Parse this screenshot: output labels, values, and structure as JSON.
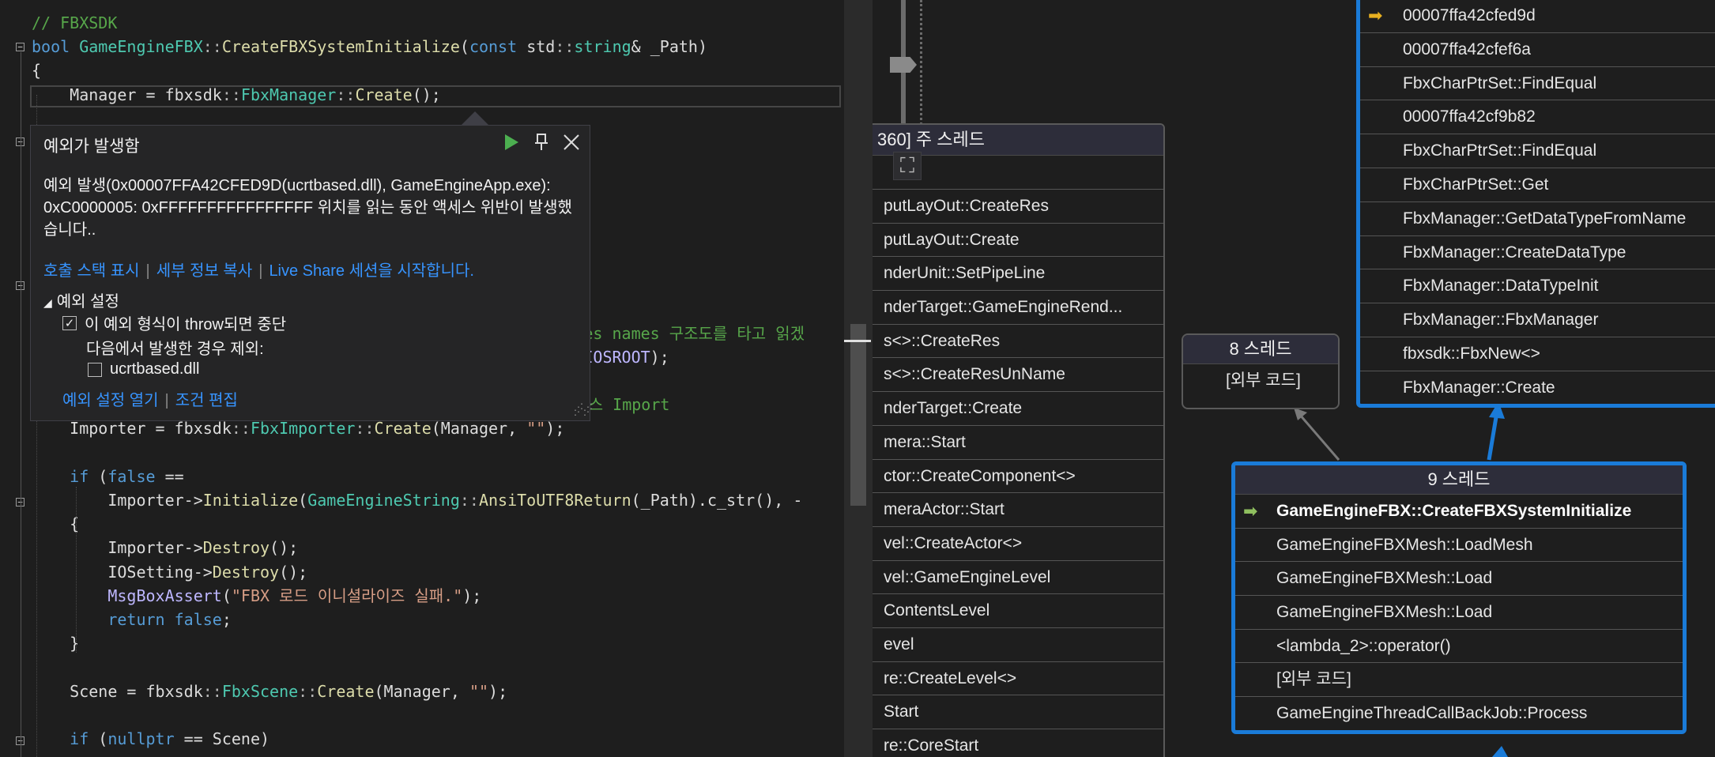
{
  "editor": {
    "lines": [
      [
        [
          "cm",
          "// FBXSDK"
        ]
      ],
      [
        [
          "kw",
          "bool "
        ],
        [
          "ty",
          "GameEngineFBX"
        ],
        [
          "op",
          "::"
        ],
        [
          "fn",
          "CreateFBXSystemInitialize"
        ],
        [
          "pl",
          "("
        ],
        [
          "kw",
          "const "
        ],
        [
          "pl",
          "std"
        ],
        [
          "op",
          "::"
        ],
        [
          "ty",
          "string"
        ],
        [
          "pl",
          "& _Path)"
        ]
      ],
      [
        [
          "pl",
          "{"
        ]
      ],
      [
        [
          "pl",
          "    Manager = fbxsdk"
        ],
        [
          "op",
          "::"
        ],
        [
          "ty",
          "FbxManager"
        ],
        [
          "op",
          "::"
        ],
        [
          "fn",
          "Create"
        ],
        [
          "pl",
          "();"
        ]
      ],
      [
        [
          "pl",
          ""
        ]
      ],
      [
        [
          "pl",
          ""
        ]
      ],
      [
        [
          "pl",
          ""
        ]
      ],
      [
        [
          "pl",
          ""
        ]
      ],
      [
        [
          "pl",
          ""
        ]
      ],
      [
        [
          "pl",
          ""
        ]
      ],
      [
        [
          "pl",
          ""
        ]
      ],
      [
        [
          "pl",
          ""
        ]
      ],
      [
        [
          "pl",
          ""
        ]
      ],
      [
        [
          "cm",
          "                                                          es names 구조도를 타고 읽겠"
        ]
      ],
      [
        [
          "mac",
          "                                                          IOSROOT"
        ],
        [
          "pl",
          ");"
        ]
      ],
      [
        [
          "pl",
          ""
        ]
      ],
      [
        [
          "cm",
          "                                                         래스 Import"
        ]
      ],
      [
        [
          "pl",
          "    Importer = fbxsdk"
        ],
        [
          "op",
          "::"
        ],
        [
          "ty",
          "FbxImporter"
        ],
        [
          "op",
          "::"
        ],
        [
          "fn",
          "Create"
        ],
        [
          "pl",
          "(Manager, "
        ],
        [
          "str",
          "\"\""
        ],
        [
          "pl",
          ");"
        ]
      ],
      [
        [
          "pl",
          ""
        ]
      ],
      [
        [
          "pl",
          "    "
        ],
        [
          "kw",
          "if "
        ],
        [
          "pl",
          "("
        ],
        [
          "kw",
          "false "
        ],
        [
          "pl",
          "=="
        ]
      ],
      [
        [
          "pl",
          "        Importer->"
        ],
        [
          "fn",
          "Initialize"
        ],
        [
          "pl",
          "("
        ],
        [
          "ty",
          "GameEngineString"
        ],
        [
          "op",
          "::"
        ],
        [
          "fn",
          "AnsiToUTF8Return"
        ],
        [
          "pl",
          "(_Path).c_str(), -"
        ]
      ],
      [
        [
          "pl",
          "    {"
        ]
      ],
      [
        [
          "pl",
          "        Importer->"
        ],
        [
          "fn",
          "Destroy"
        ],
        [
          "pl",
          "();"
        ]
      ],
      [
        [
          "pl",
          "        IOSetting->"
        ],
        [
          "fn",
          "Destroy"
        ],
        [
          "pl",
          "();"
        ]
      ],
      [
        [
          "pl",
          "        "
        ],
        [
          "mac",
          "MsgBoxAssert"
        ],
        [
          "pl",
          "("
        ],
        [
          "str",
          "\"FBX 로드 이니셜라이즈 실패.\""
        ],
        [
          "pl",
          ");"
        ]
      ],
      [
        [
          "pl",
          "        "
        ],
        [
          "kw",
          "return false"
        ],
        [
          "pl",
          ";"
        ]
      ],
      [
        [
          "pl",
          "    }"
        ]
      ],
      [
        [
          "pl",
          ""
        ]
      ],
      [
        [
          "pl",
          "    Scene = fbxsdk"
        ],
        [
          "op",
          "::"
        ],
        [
          "ty",
          "FbxScene"
        ],
        [
          "op",
          "::"
        ],
        [
          "fn",
          "Create"
        ],
        [
          "pl",
          "(Manager, "
        ],
        [
          "str",
          "\"\""
        ],
        [
          "pl",
          ");"
        ]
      ],
      [
        [
          "pl",
          ""
        ]
      ],
      [
        [
          "pl",
          "    "
        ],
        [
          "kw",
          "if "
        ],
        [
          "pl",
          "("
        ],
        [
          "kw",
          "nullptr "
        ],
        [
          "pl",
          "== Scene)"
        ]
      ]
    ]
  },
  "exception_popup": {
    "title": "예외가 발생함",
    "message": "예외 발생(0x00007FFA42CFED9D(ucrtbased.dll), GameEngineApp.exe): 0xC0000005: 0xFFFFFFFFFFFFFFFF 위치를 읽는 동안 액세스 위반이 발생했습니다..",
    "links": [
      "호출 스택 표시",
      "세부 정보 복사",
      "Live Share 세션을 시작합니다."
    ],
    "settings_header": "예외 설정",
    "break_when_thrown": "이 예외 형식이 throw되면 중단",
    "except_when_from": "다음에서 발생한 경우 제외:",
    "module": "ucrtbased.dll",
    "break_checked": true,
    "module_checked": false,
    "bottom_links": [
      "예외 설정 열기",
      "조건 편집"
    ],
    "icons": [
      "continue-icon",
      "pin-icon",
      "close-icon"
    ]
  },
  "stacks": {
    "main_thread": {
      "header": "360] 주 스레드",
      "frames": [
        "putLayOut::CreateRes",
        "putLayOut::Create",
        "nderUnit::SetPipeLine",
        "nderTarget::GameEngineRend...",
        "s<>::CreateRes",
        "s<>::CreateResUnName",
        "nderTarget::Create",
        "mera::Start",
        "ctor::CreateComponent<>",
        "meraActor::Start",
        "vel::CreateActor<>",
        "vel::GameEngineLevel",
        "ContentsLevel",
        "evel",
        "re::CreateLevel<>",
        "Start",
        "re::CoreStart"
      ]
    },
    "thread8": {
      "header": "8 스레드",
      "frames": [
        "[외부 코드]"
      ]
    },
    "thread9": {
      "header": "9 스레드",
      "frames": [
        "GameEngineFBX::CreateFBXSystemInitialize",
        "GameEngineFBXMesh::LoadMesh",
        "GameEngineFBXMesh::Load",
        "GameEngineFBXMesh::Load",
        "<lambda_2>::operator()",
        "[외부 코드]",
        "GameEngineThreadCallBackJob::Process"
      ]
    },
    "top_right": {
      "frames": [
        "00007ffa42cfed9d",
        "00007ffa42cfef6a",
        "FbxCharPtrSet::FindEqual",
        "00007ffa42cf9b82",
        "FbxCharPtrSet::FindEqual",
        "FbxCharPtrSet::Get",
        "FbxManager::GetDataTypeFromName",
        "FbxManager::CreateDataType",
        "FbxManager::DataTypeInit",
        "FbxManager::FbxManager",
        "fbxsdk::FbxNew<>",
        "FbxManager::Create"
      ]
    },
    "colors": {
      "active_border": "#1a7bd8",
      "current_arrow": "#e8b020",
      "return_arrow": "#8fbf5f"
    }
  }
}
